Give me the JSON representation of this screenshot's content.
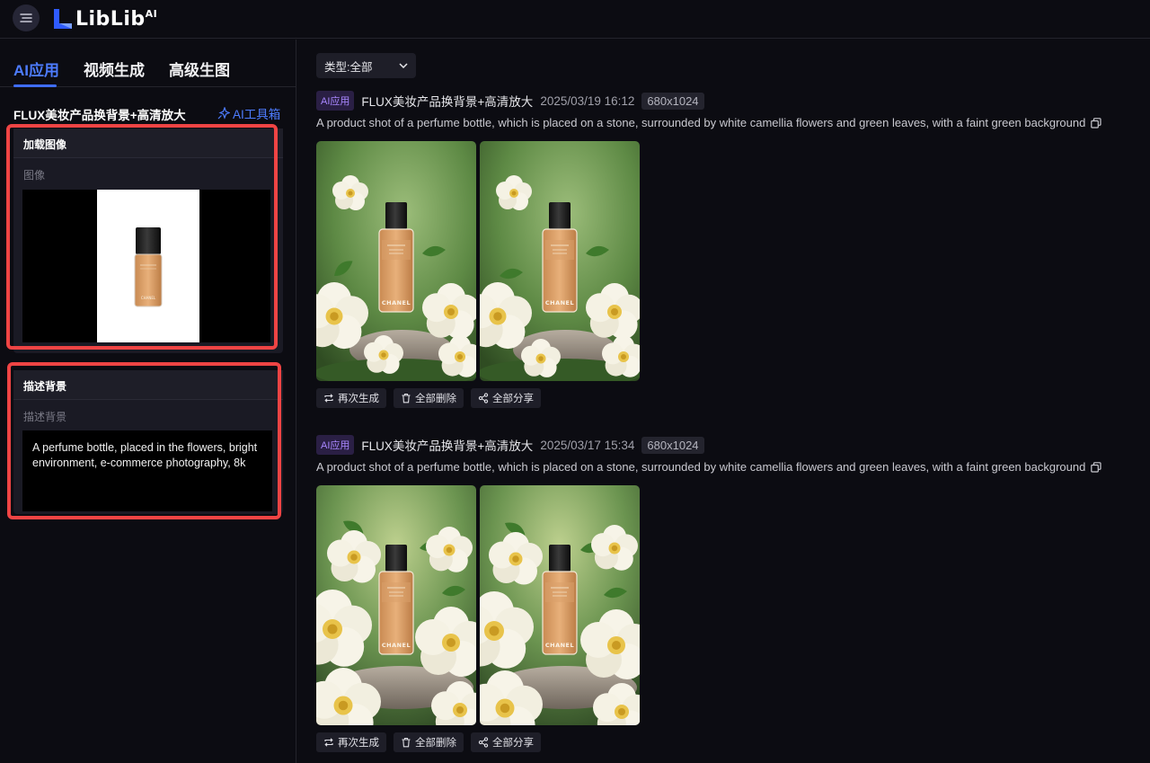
{
  "app": {
    "logo_text": "LibLib",
    "logo_sup": "AI"
  },
  "tabs": [
    {
      "label": "AI应用",
      "active": true
    },
    {
      "label": "视频生成",
      "active": false
    },
    {
      "label": "高级生图",
      "active": false
    }
  ],
  "tool": {
    "title": "FLUX美妆产品换背景+高清放大",
    "toolbox_label": "AI工具箱"
  },
  "load_image": {
    "header": "加载图像",
    "sublabel": "图像"
  },
  "describe": {
    "header": "描述背景",
    "sublabel": "描述背景",
    "value": "A perfume bottle, placed in the flowers, bright environment, e-commerce photography, 8k"
  },
  "filter": {
    "label": "类型:全部"
  },
  "results": [
    {
      "badge": "AI应用",
      "title": "FLUX美妆产品换背景+高清放大",
      "time": "2025/03/19 16:12",
      "size": "680x1024",
      "prompt": "A product shot of a perfume bottle, which is placed on a stone, surrounded by white camellia flowers and green leaves, with a faint green background"
    },
    {
      "badge": "AI应用",
      "title": "FLUX美妆产品换背景+高清放大",
      "time": "2025/03/17 15:34",
      "size": "680x1024",
      "prompt": "A product shot of a perfume bottle, which is placed on a stone, surrounded by white camellia flowers and green leaves, with a faint green background"
    }
  ],
  "actions": {
    "regenerate": "再次生成",
    "delete_all": "全部删除",
    "share_all": "全部分享"
  },
  "product_label": "CHANEL",
  "colors": {
    "accent": "#4d7cff",
    "highlight_frame": "#ef4444",
    "badge_app": "#a987ff"
  }
}
